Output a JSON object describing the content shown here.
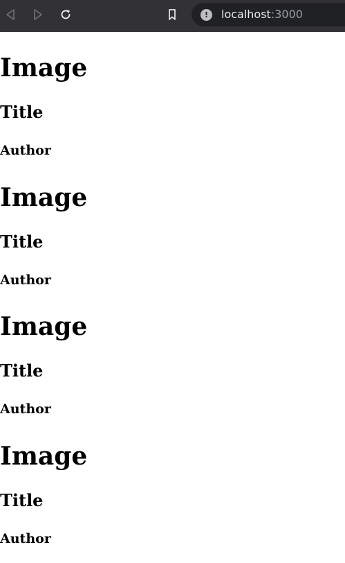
{
  "browser": {
    "url_host": "localhost",
    "url_port": ":3000",
    "icons": {
      "back": "back-arrow-icon",
      "forward": "forward-arrow-icon",
      "reload": "reload-icon",
      "bookmark": "bookmark-icon",
      "site_info": "info-icon"
    },
    "info_glyph": "!"
  },
  "cards": [
    {
      "image": "Image",
      "title": "Title",
      "author": "Author"
    },
    {
      "image": "Image",
      "title": "Title",
      "author": "Author"
    },
    {
      "image": "Image",
      "title": "Title",
      "author": "Author"
    },
    {
      "image": "Image",
      "title": "Title",
      "author": "Author"
    }
  ],
  "colors": {
    "toolbar_bg": "#323234",
    "urlbar_bg": "#202124",
    "page_bg": "#ffffff",
    "text": "#000000"
  }
}
